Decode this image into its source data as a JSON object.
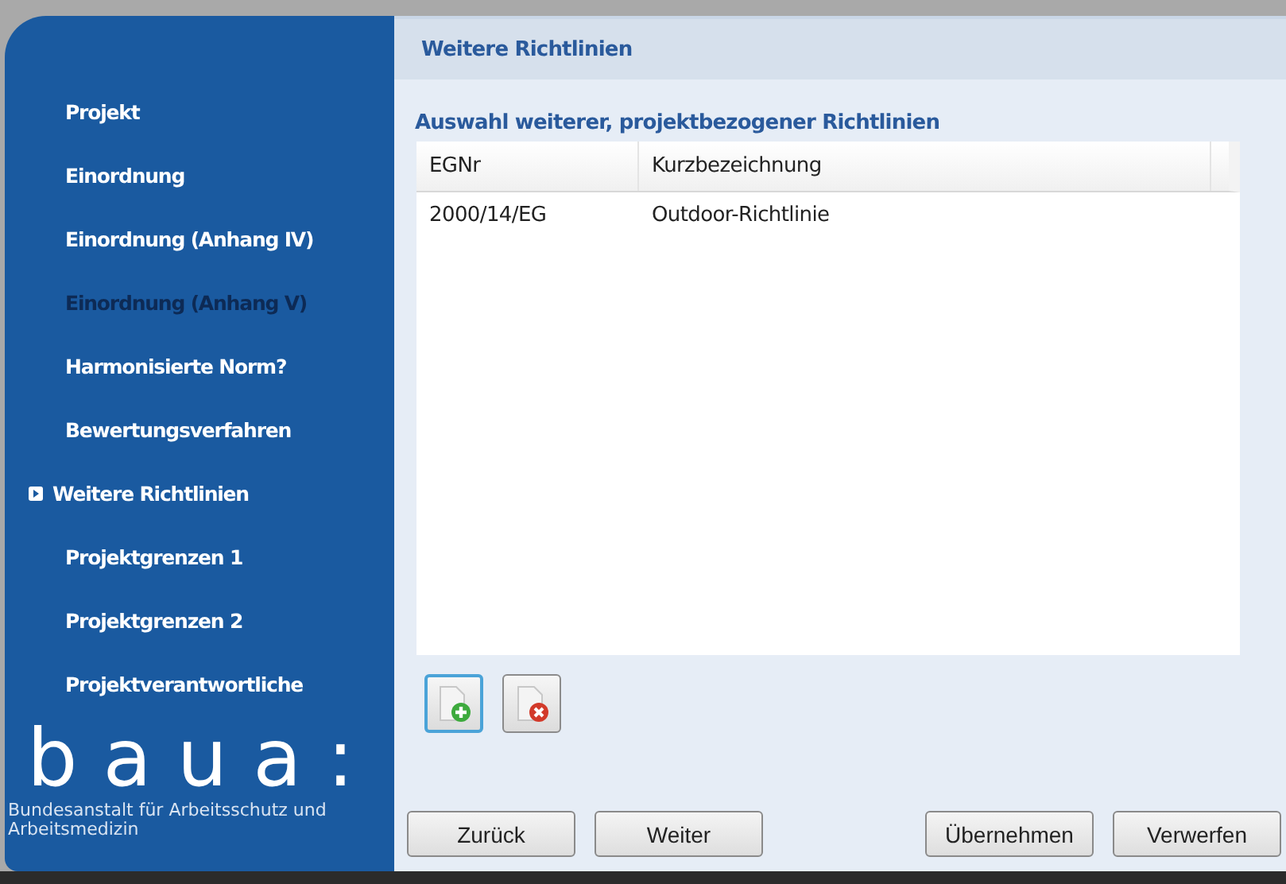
{
  "sidebar": {
    "items": [
      {
        "label": "Projekt",
        "selected": false,
        "disabled": false
      },
      {
        "label": "Einordnung",
        "selected": false,
        "disabled": false
      },
      {
        "label": "Einordnung (Anhang IV)",
        "selected": false,
        "disabled": false
      },
      {
        "label": "Einordnung (Anhang V)",
        "selected": false,
        "disabled": true
      },
      {
        "label": "Harmonisierte Norm?",
        "selected": false,
        "disabled": false
      },
      {
        "label": "Bewertungsverfahren",
        "selected": false,
        "disabled": false
      },
      {
        "label": "Weitere Richtlinien",
        "selected": true,
        "disabled": false
      },
      {
        "label": "Projektgrenzen 1",
        "selected": false,
        "disabled": false
      },
      {
        "label": "Projektgrenzen 2",
        "selected": false,
        "disabled": false
      },
      {
        "label": "Projektverantwortliche",
        "selected": false,
        "disabled": false
      }
    ],
    "logo": {
      "text": "baua:",
      "subtitle": "Bundesanstalt für Arbeitsschutz und Arbeitsmedizin"
    }
  },
  "page": {
    "title": "Weitere Richtlinien",
    "section": "Auswahl weiterer, projektbezogener Richtlinien"
  },
  "table": {
    "columns": [
      "EGNr",
      "Kurzbezeichnung"
    ],
    "rows": [
      [
        "2000/14/EG",
        "Outdoor-Richtlinie"
      ]
    ]
  },
  "buttons": [
    "Zurück",
    "Weiter",
    "Übernehmen",
    "Verwerfen"
  ]
}
